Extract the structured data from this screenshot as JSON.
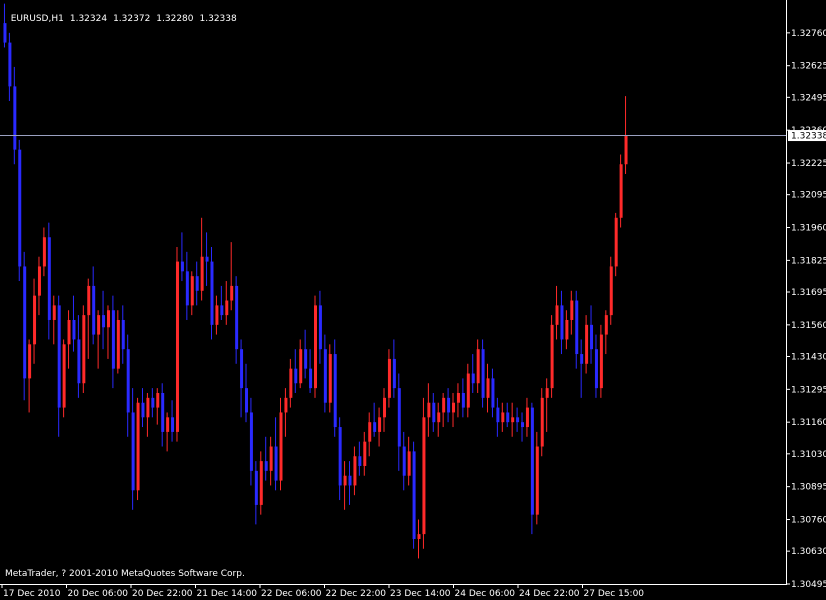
{
  "header": {
    "symbol": "EURUSD,H1",
    "open": "1.32324",
    "high": "1.32372",
    "low": "1.32280",
    "close": "1.32338"
  },
  "copyright": "MetaTrader, ? 2001-2010 MetaQuotes Software Corp.",
  "colors": {
    "background": "#000000",
    "axis": "#ffffff",
    "up": "#ff2a2a",
    "down": "#2a2aff",
    "price_line": "#9aa0c0"
  },
  "chart_data": {
    "type": "candlestick",
    "ylim": [
      1.30495,
      1.32895
    ],
    "y_ticks": [
      "1.32760",
      "1.32625",
      "1.32495",
      "1.32360",
      "1.32225",
      "1.32095",
      "1.31960",
      "1.31825",
      "1.31695",
      "1.31560",
      "1.31430",
      "1.31295",
      "1.31160",
      "1.31030",
      "1.30895",
      "1.30760",
      "1.30630",
      "1.30495"
    ],
    "x_ticks": [
      "17 Dec 2010",
      "20 Dec 06:00",
      "20 Dec 22:00",
      "21 Dec 14:00",
      "22 Dec 06:00",
      "22 Dec 22:00",
      "23 Dec 14:00",
      "24 Dec 06:00",
      "24 Dec 22:00",
      "27 Dec 15:00"
    ],
    "current_price": "1.32338",
    "candles": [
      [
        1.328,
        1.3288,
        1.327,
        1.3272
      ],
      [
        1.3272,
        1.3276,
        1.3248,
        1.3254
      ],
      [
        1.3254,
        1.3262,
        1.3222,
        1.3228
      ],
      [
        1.3228,
        1.3232,
        1.3174,
        1.318
      ],
      [
        1.318,
        1.3186,
        1.3125,
        1.3134
      ],
      [
        1.3134,
        1.315,
        1.312,
        1.3148
      ],
      [
        1.3148,
        1.3175,
        1.314,
        1.3168
      ],
      [
        1.3168,
        1.3184,
        1.316,
        1.318
      ],
      [
        1.318,
        1.3196,
        1.3176,
        1.3192
      ],
      [
        1.3192,
        1.3198,
        1.315,
        1.3158
      ],
      [
        1.3158,
        1.3168,
        1.3148,
        1.3164
      ],
      [
        1.3164,
        1.3168,
        1.311,
        1.3122
      ],
      [
        1.3122,
        1.315,
        1.3118,
        1.3148
      ],
      [
        1.3148,
        1.3162,
        1.3138,
        1.3158
      ],
      [
        1.3158,
        1.3168,
        1.3145,
        1.315
      ],
      [
        1.315,
        1.316,
        1.3126,
        1.3132
      ],
      [
        1.3132,
        1.3164,
        1.3128,
        1.316
      ],
      [
        1.316,
        1.3175,
        1.3142,
        1.3172
      ],
      [
        1.3172,
        1.318,
        1.3148,
        1.3152
      ],
      [
        1.3152,
        1.3162,
        1.3138,
        1.316
      ],
      [
        1.316,
        1.317,
        1.3146,
        1.3155
      ],
      [
        1.3155,
        1.3164,
        1.3142,
        1.3162
      ],
      [
        1.3162,
        1.3168,
        1.313,
        1.3138
      ],
      [
        1.3138,
        1.3162,
        1.3136,
        1.3158
      ],
      [
        1.3158,
        1.3164,
        1.314,
        1.3146
      ],
      [
        1.3146,
        1.3152,
        1.311,
        1.312
      ],
      [
        1.312,
        1.313,
        1.308,
        1.3088
      ],
      [
        1.3088,
        1.3126,
        1.3084,
        1.3124
      ],
      [
        1.3124,
        1.313,
        1.3114,
        1.3118
      ],
      [
        1.3118,
        1.3128,
        1.311,
        1.3126
      ],
      [
        1.3126,
        1.313,
        1.3118,
        1.3122
      ],
      [
        1.3122,
        1.313,
        1.3115,
        1.3128
      ],
      [
        1.3128,
        1.3132,
        1.3106,
        1.3112
      ],
      [
        1.3112,
        1.312,
        1.3104,
        1.3118
      ],
      [
        1.3118,
        1.3125,
        1.3108,
        1.3112
      ],
      [
        1.3112,
        1.3188,
        1.3108,
        1.3182
      ],
      [
        1.3182,
        1.3194,
        1.3174,
        1.3178
      ],
      [
        1.3178,
        1.3186,
        1.3158,
        1.3164
      ],
      [
        1.3164,
        1.3178,
        1.316,
        1.3176
      ],
      [
        1.3176,
        1.3182,
        1.3164,
        1.317
      ],
      [
        1.317,
        1.32,
        1.3166,
        1.3184
      ],
      [
        1.3184,
        1.3194,
        1.3172,
        1.3182
      ],
      [
        1.3182,
        1.3188,
        1.315,
        1.3156
      ],
      [
        1.3156,
        1.3168,
        1.3152,
        1.3164
      ],
      [
        1.3164,
        1.3172,
        1.3158,
        1.316
      ],
      [
        1.316,
        1.3174,
        1.3156,
        1.3166
      ],
      [
        1.3166,
        1.319,
        1.3162,
        1.3172
      ],
      [
        1.3172,
        1.3176,
        1.314,
        1.3146
      ],
      [
        1.3146,
        1.315,
        1.3118,
        1.313
      ],
      [
        1.313,
        1.314,
        1.3116,
        1.312
      ],
      [
        1.312,
        1.3126,
        1.309,
        1.3096
      ],
      [
        1.3096,
        1.31,
        1.3074,
        1.3082
      ],
      [
        1.3082,
        1.3104,
        1.3078,
        1.31
      ],
      [
        1.31,
        1.311,
        1.3092,
        1.3096
      ],
      [
        1.3096,
        1.311,
        1.309,
        1.3106
      ],
      [
        1.3106,
        1.3118,
        1.3088,
        1.3092
      ],
      [
        1.3092,
        1.3126,
        1.3088,
        1.312
      ],
      [
        1.312,
        1.313,
        1.311,
        1.3126
      ],
      [
        1.3126,
        1.3142,
        1.3122,
        1.3138
      ],
      [
        1.3138,
        1.3146,
        1.3128,
        1.3132
      ],
      [
        1.3132,
        1.315,
        1.313,
        1.3146
      ],
      [
        1.3146,
        1.3154,
        1.3134,
        1.3138
      ],
      [
        1.3138,
        1.3146,
        1.3128,
        1.313
      ],
      [
        1.313,
        1.3168,
        1.3126,
        1.3164
      ],
      [
        1.3164,
        1.317,
        1.314,
        1.3146
      ],
      [
        1.3146,
        1.3152,
        1.312,
        1.3124
      ],
      [
        1.3124,
        1.3148,
        1.312,
        1.3144
      ],
      [
        1.3144,
        1.315,
        1.311,
        1.3114
      ],
      [
        1.3114,
        1.3118,
        1.3084,
        1.309
      ],
      [
        1.309,
        1.31,
        1.308,
        1.3094
      ],
      [
        1.3094,
        1.31,
        1.3082,
        1.309
      ],
      [
        1.309,
        1.3106,
        1.3086,
        1.3102
      ],
      [
        1.3102,
        1.3108,
        1.3094,
        1.3098
      ],
      [
        1.3098,
        1.3112,
        1.3094,
        1.3108
      ],
      [
        1.3108,
        1.312,
        1.3102,
        1.3116
      ],
      [
        1.3116,
        1.3124,
        1.311,
        1.3112
      ],
      [
        1.3112,
        1.3122,
        1.3106,
        1.3118
      ],
      [
        1.3118,
        1.313,
        1.3112,
        1.3126
      ],
      [
        1.3126,
        1.3146,
        1.3122,
        1.3142
      ],
      [
        1.3142,
        1.315,
        1.3126,
        1.313
      ],
      [
        1.313,
        1.3136,
        1.3096,
        1.3106
      ],
      [
        1.3106,
        1.3112,
        1.3088,
        1.3094
      ],
      [
        1.3094,
        1.311,
        1.309,
        1.3104
      ],
      [
        1.3104,
        1.3108,
        1.3064,
        1.3068
      ],
      [
        1.3068,
        1.3076,
        1.306,
        1.307
      ],
      [
        1.307,
        1.3126,
        1.3064,
        1.3118
      ],
      [
        1.3118,
        1.3132,
        1.311,
        1.3124
      ],
      [
        1.3124,
        1.3128,
        1.3112,
        1.3116
      ],
      [
        1.3116,
        1.3124,
        1.311,
        1.312
      ],
      [
        1.312,
        1.3128,
        1.3114,
        1.3126
      ],
      [
        1.3126,
        1.313,
        1.3116,
        1.312
      ],
      [
        1.312,
        1.3128,
        1.3114,
        1.3124
      ],
      [
        1.3124,
        1.3132,
        1.3118,
        1.3128
      ],
      [
        1.3128,
        1.3134,
        1.3118,
        1.3122
      ],
      [
        1.3122,
        1.314,
        1.3118,
        1.3136
      ],
      [
        1.3136,
        1.3144,
        1.3128,
        1.3132
      ],
      [
        1.3132,
        1.315,
        1.3128,
        1.3146
      ],
      [
        1.3146,
        1.315,
        1.3122,
        1.3126
      ],
      [
        1.3126,
        1.314,
        1.312,
        1.3134
      ],
      [
        1.3134,
        1.3138,
        1.3118,
        1.3122
      ],
      [
        1.3122,
        1.3126,
        1.311,
        1.3116
      ],
      [
        1.3116,
        1.3124,
        1.3112,
        1.312
      ],
      [
        1.312,
        1.3124,
        1.3114,
        1.3116
      ],
      [
        1.3116,
        1.3124,
        1.311,
        1.3118
      ],
      [
        1.3118,
        1.3122,
        1.3112,
        1.3116
      ],
      [
        1.3116,
        1.312,
        1.3108,
        1.3114
      ],
      [
        1.3114,
        1.3126,
        1.311,
        1.3122
      ],
      [
        1.3122,
        1.3124,
        1.307,
        1.3078
      ],
      [
        1.3078,
        1.3112,
        1.3074,
        1.3106
      ],
      [
        1.3106,
        1.313,
        1.3102,
        1.3126
      ],
      [
        1.3126,
        1.3134,
        1.3112,
        1.313
      ],
      [
        1.313,
        1.316,
        1.3126,
        1.3156
      ],
      [
        1.3156,
        1.3172,
        1.315,
        1.3164
      ],
      [
        1.3164,
        1.317,
        1.3144,
        1.315
      ],
      [
        1.315,
        1.3162,
        1.3146,
        1.3158
      ],
      [
        1.3158,
        1.317,
        1.3152,
        1.3166
      ],
      [
        1.3166,
        1.317,
        1.3138,
        1.3144
      ],
      [
        1.3144,
        1.315,
        1.3126,
        1.314
      ],
      [
        1.314,
        1.316,
        1.3136,
        1.3156
      ],
      [
        1.3156,
        1.3164,
        1.314,
        1.3146
      ],
      [
        1.3146,
        1.3152,
        1.3126,
        1.313
      ],
      [
        1.313,
        1.3156,
        1.3126,
        1.3152
      ],
      [
        1.3152,
        1.3162,
        1.3144,
        1.316
      ],
      [
        1.316,
        1.3184,
        1.3156,
        1.318
      ],
      [
        1.318,
        1.3202,
        1.3176,
        1.32
      ],
      [
        1.32,
        1.3226,
        1.3196,
        1.3222
      ],
      [
        1.3222,
        1.325,
        1.3218,
        1.3234
      ]
    ]
  }
}
